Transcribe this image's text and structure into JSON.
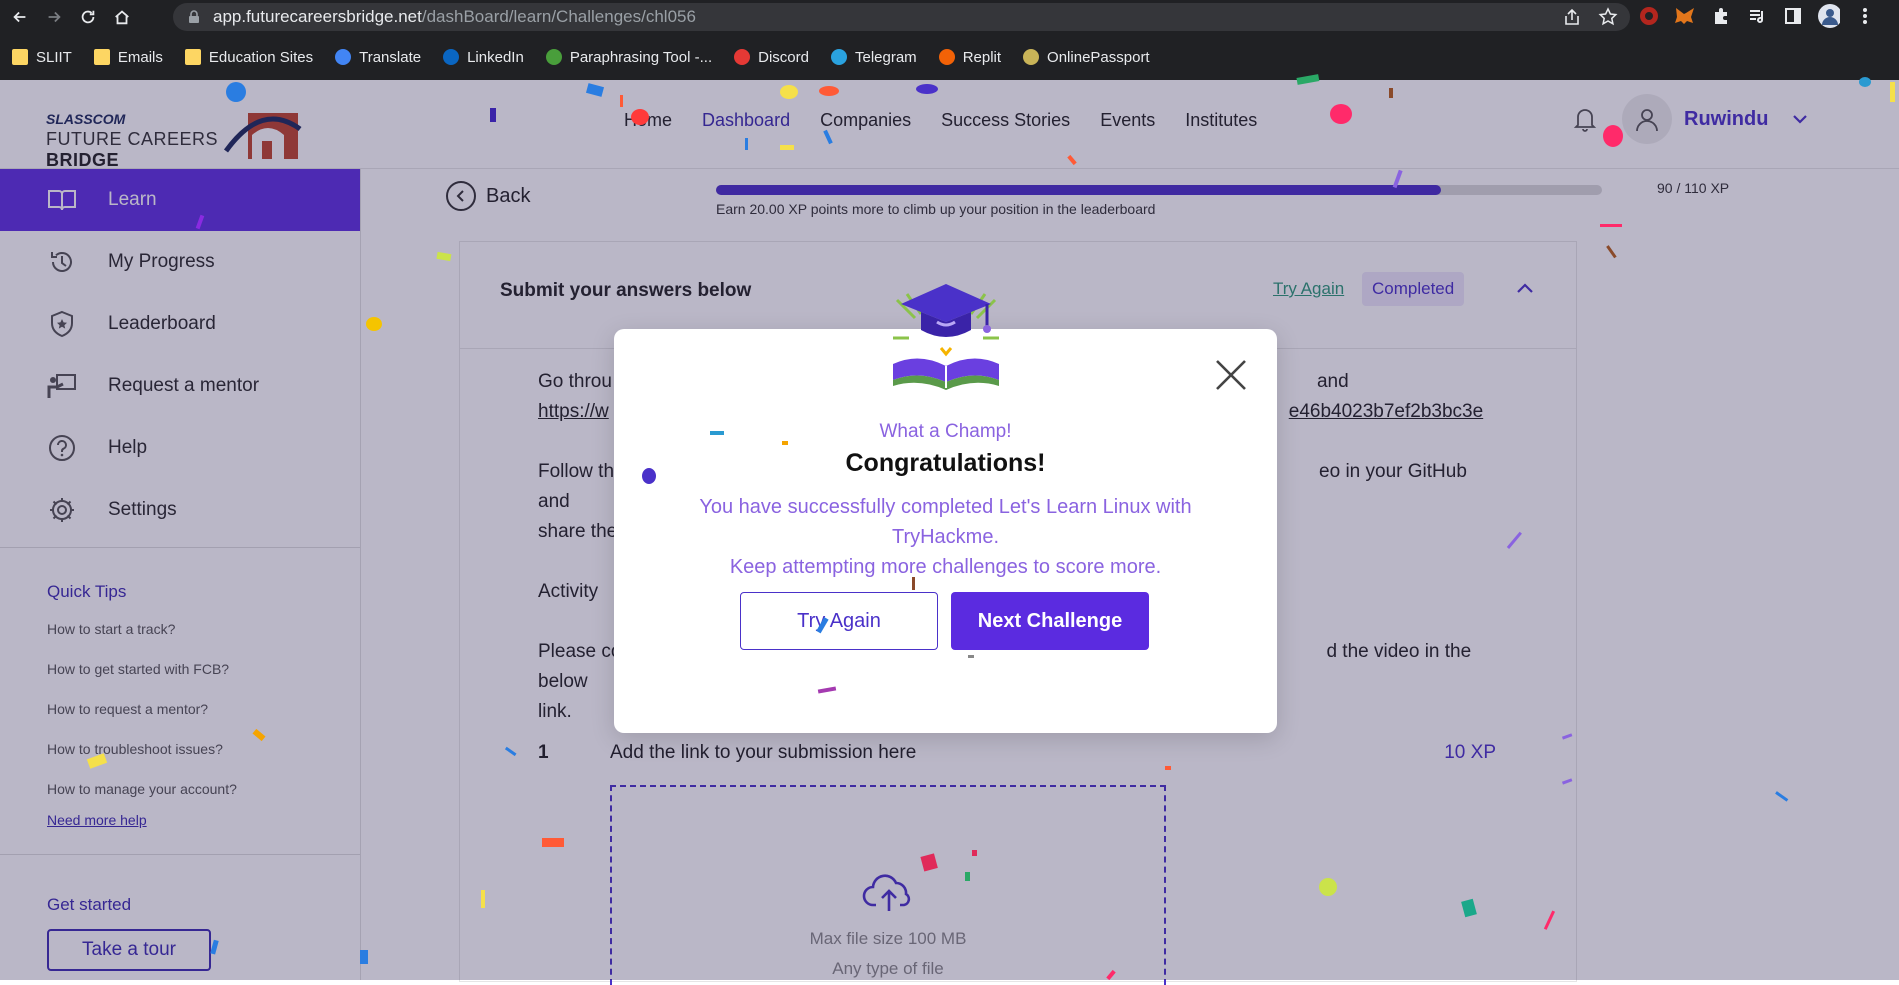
{
  "browser": {
    "url_host": "app.futurecareersbridge.net",
    "url_path": "/dashBoard/learn/Challenges/chl056",
    "bookmarks": [
      {
        "label": "SLIIT",
        "icon": "folder-icon"
      },
      {
        "label": "Emails",
        "icon": "folder-icon"
      },
      {
        "label": "Education Sites",
        "icon": "folder-icon"
      },
      {
        "label": "Translate",
        "icon": "translate-icon"
      },
      {
        "label": "LinkedIn",
        "icon": "linkedin-icon"
      },
      {
        "label": "Paraphrasing Tool -...",
        "icon": "quillbot-icon"
      },
      {
        "label": "Discord",
        "icon": "discord-icon"
      },
      {
        "label": "Telegram",
        "icon": "telegram-icon"
      },
      {
        "label": "Replit",
        "icon": "replit-icon"
      },
      {
        "label": "OnlinePassport",
        "icon": "passport-icon"
      }
    ]
  },
  "header": {
    "logo_line1": "SLASSCOM",
    "logo_line2_a": "FUTURE CAREERS ",
    "logo_line2_b": "BRIDGE",
    "nav": [
      {
        "label": "Home",
        "active": false
      },
      {
        "label": "Dashboard",
        "active": true
      },
      {
        "label": "Companies",
        "active": false
      },
      {
        "label": "Success Stories",
        "active": false
      },
      {
        "label": "Events",
        "active": false
      },
      {
        "label": "Institutes",
        "active": false
      }
    ],
    "username": "Ruwindu"
  },
  "sidebar": {
    "items": [
      {
        "label": "Learn",
        "icon": "book-icon",
        "active": true
      },
      {
        "label": "My Progress",
        "icon": "history-icon",
        "active": false
      },
      {
        "label": "Leaderboard",
        "icon": "shield-icon",
        "active": false
      },
      {
        "label": "Request a mentor",
        "icon": "mentor-icon",
        "active": false
      },
      {
        "label": "Help",
        "icon": "help-icon",
        "active": false
      },
      {
        "label": "Settings",
        "icon": "gear-icon",
        "active": false
      }
    ],
    "quick_tips_title": "Quick Tips",
    "tips": [
      "How to start a track?",
      "How to get started with FCB?",
      "How to request a mentor?",
      "How to troubleshoot issues?",
      "How to manage your account?"
    ],
    "need_help": "Need more help",
    "get_started": "Get started",
    "tour_button": "Take a tour"
  },
  "main": {
    "back_label": "Back",
    "progress": {
      "current_xp": 90,
      "total_xp": 110,
      "fraction": 0.818,
      "label": "90 / 110 XP",
      "message": "Earn 20.00 XP points more to climb up your position in the leaderboard"
    },
    "card": {
      "title": "Submit your answers below",
      "try_again": "Try Again",
      "status": "Completed",
      "para1_start": "Go throu",
      "para1_end": "and",
      "link_start": "https://w",
      "link_end": "e46b4023b7ef2b3bc3e",
      "para2_start": "Follow th",
      "para2_end": "eo in your GitHub and",
      "para2_line2": "share the",
      "para3": "Activity",
      "para4_start": "Please co",
      "para4_end": "d the video in the below",
      "para4_line2": "link.",
      "question_number": "1",
      "question_label": "Add the link to your submission here",
      "question_xp": "10 XP",
      "dropzone_line1": "Max file size 100 MB",
      "dropzone_line2": "Any type of file"
    }
  },
  "modal": {
    "subtitle": "What a Champ!",
    "title": "Congratulations!",
    "message_line1": "You have successfully completed Let's Learn Linux with TryHackme.",
    "message_line2": "Keep attempting more challenges to score more.",
    "try_again_button": "Try Again",
    "next_button": "Next Challenge"
  },
  "colors": {
    "brand_purple": "#5b2be0",
    "accent_purple": "#4a31c9",
    "light_purple_text": "#8a63e0",
    "green_link": "#2f9a7a"
  }
}
